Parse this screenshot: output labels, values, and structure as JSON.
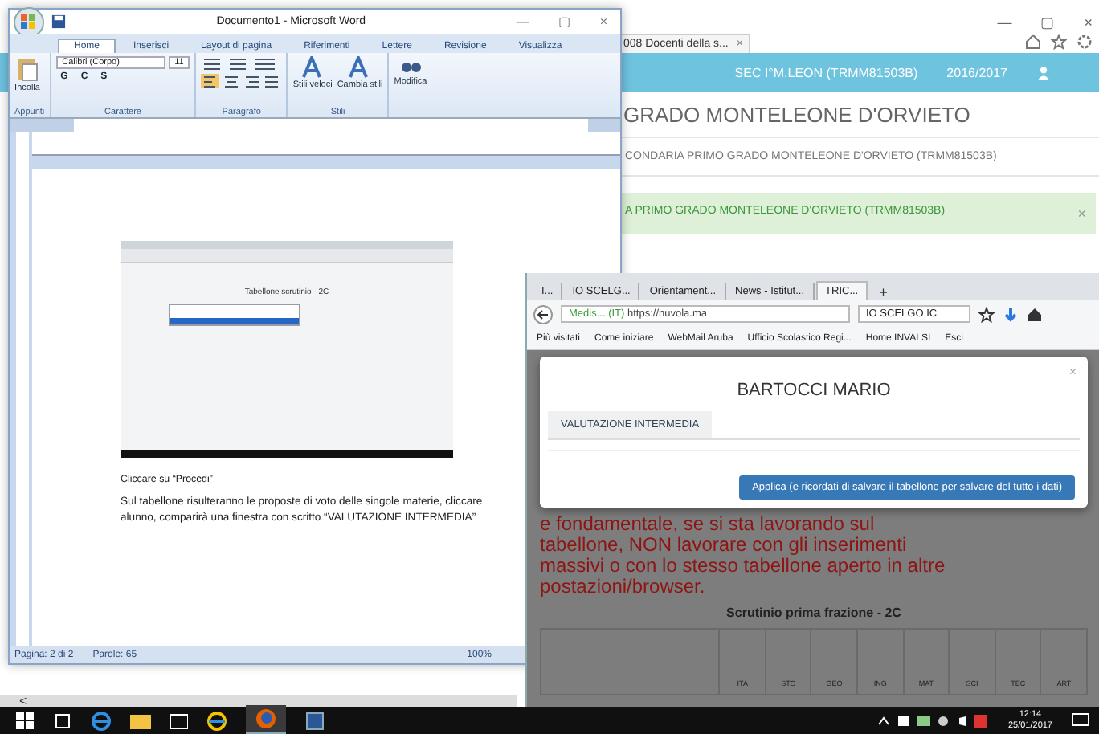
{
  "back_browser": {
    "window_controls": [
      "—",
      "▢",
      "×"
    ],
    "tab": {
      "label": "008 Docenti della s...",
      "close": "×"
    },
    "header": {
      "school": "SEC I°M.LEON (TRMM81503B)",
      "year": "2016/2017"
    },
    "title": "GRADO MONTELEONE D'ORVIETO",
    "breadcrumb": "CONDARIA PRIMO GRADO MONTELEONE D'ORVIETO (TRMM81503B)",
    "alert": {
      "text": "A PRIMO GRADO MONTELEONE D'ORVIETO (TRMM81503B)",
      "close": "×"
    },
    "scroll_arrow": "<"
  },
  "word": {
    "title": "Documento1 - Microsoft Word",
    "window_controls": [
      "—",
      "▢",
      "×"
    ],
    "tabs": [
      {
        "label": "Home",
        "selected": true
      },
      {
        "label": "Inserisci",
        "selected": false
      },
      {
        "label": "Layout di pagina",
        "selected": false
      },
      {
        "label": "Riferimenti",
        "selected": false
      },
      {
        "label": "Lettere",
        "selected": false
      },
      {
        "label": "Revisione",
        "selected": false
      },
      {
        "label": "Visualizza",
        "selected": false
      }
    ],
    "paste": "Incolla",
    "font": "Calibri (Corpo)",
    "size": "11",
    "format_keys": [
      "G",
      "C",
      "S"
    ],
    "styles": [
      "Stili veloci",
      "Cambia stili"
    ],
    "edit": "Modifica",
    "groups": [
      "Appunti",
      "Carattere",
      "Paragrafo",
      "Stili"
    ],
    "embedded": {
      "title": "Tabellone scrutinio - 2C"
    },
    "doc_lines": [
      "Cliccare su “Procedi”"
    ],
    "paragraph": [
      "Sul tabellone risulteranno le proposte di voto delle singole materie, cliccare",
      "alunno, comparirà una finestra con scritto “VALUTAZIONE INTERMEDIA”"
    ],
    "status": {
      "page": "Pagina: 2 di 2",
      "words": "Parole: 65",
      "zoom": "100%"
    }
  },
  "firefox": {
    "tabs": [
      {
        "label": "I...",
        "selected": false
      },
      {
        "label": "IO SCELG...",
        "selected": false
      },
      {
        "label": "Orientament...",
        "selected": false
      },
      {
        "label": "News - Istitut...",
        "selected": false
      },
      {
        "label": "TRIC...",
        "selected": true
      }
    ],
    "new_tab": "+",
    "url_site": "Medis...",
    "url_country": "(IT)",
    "url": "https://nuvola.ma",
    "search": "IO SCELGO IC",
    "bookmarks": [
      "Più visitati",
      "Come iniziare",
      "WebMail Aruba",
      "Ufficio Scolastico Regi...",
      "Home INVALSI",
      "Esci"
    ],
    "modal": {
      "title": "BARTOCCI MARIO",
      "close": "×",
      "tab": "VALUTAZIONE INTERMEDIA",
      "button": "Applica (e ricordati di salvare il tabellone per salvare del tutto i dati)"
    },
    "warning": [
      "e fondamentale, se si sta lavorando sul",
      "tabellone, NON lavorare con gli inserimenti",
      "massivi o con lo stesso tabellone aperto in altre",
      "postazioni/browser."
    ],
    "table_title": "Scrutinio prima frazione - 2C",
    "columns": [
      "ITA",
      "STO",
      "GEO",
      "ING",
      "MAT",
      "SCI",
      "TEC",
      "ART"
    ]
  },
  "taskbar": {
    "time": "12:14",
    "date": "25/01/2017"
  }
}
